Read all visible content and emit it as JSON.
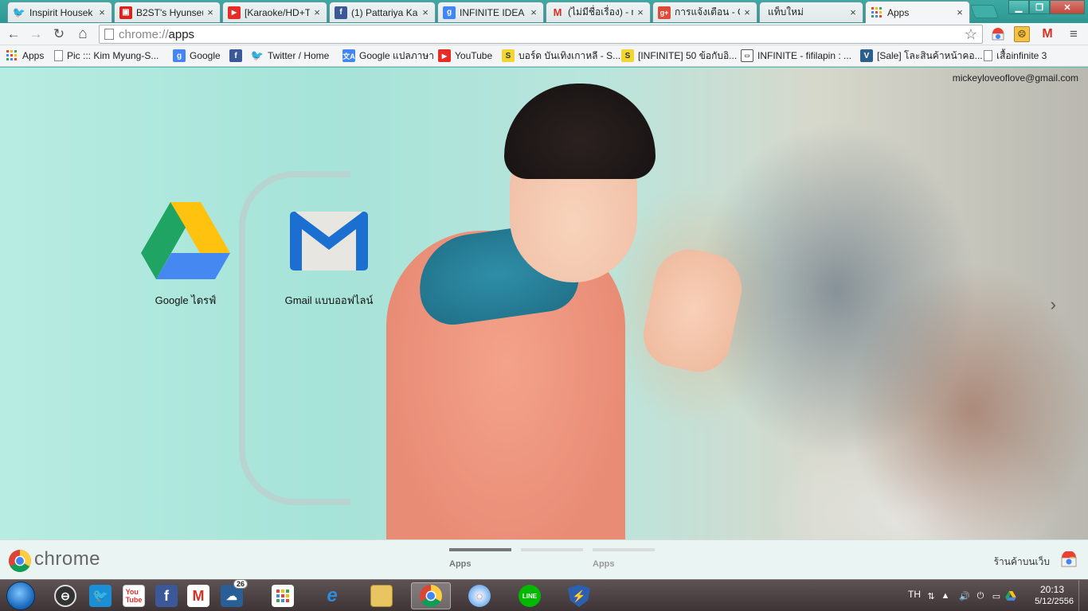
{
  "tabs": [
    {
      "label": "Inspirit Housek",
      "icon": "twitter-icon",
      "active": false
    },
    {
      "label": "B2ST's Hyunseu",
      "icon": "red-square-icon",
      "active": false
    },
    {
      "label": "[Karaoke/HD+T",
      "icon": "youtube-icon",
      "active": false
    },
    {
      "label": "(1) Pattariya Ka",
      "icon": "facebook-icon",
      "active": false
    },
    {
      "label": "INFINITE IDEA |",
      "icon": "google-icon",
      "active": false
    },
    {
      "label": "(ไม่มีชื่อเรื่อง) - m",
      "icon": "gmail-icon",
      "active": false
    },
    {
      "label": "การแจ้งเตือน - G",
      "icon": "google-plus-icon",
      "active": false
    },
    {
      "label": "แท็บใหม่",
      "icon": "",
      "active": false
    },
    {
      "label": "Apps",
      "icon": "apps-grid-icon",
      "active": true
    }
  ],
  "tab_close_glyph": "×",
  "toolbar": {
    "url_scheme": "chrome://",
    "url_host": "apps",
    "back": "←",
    "forward": "→",
    "reload": "↻",
    "home": "⌂",
    "star": "☆"
  },
  "bookmarks": [
    {
      "label": "Apps",
      "icon": "apps-grid-icon"
    },
    {
      "label": "Pic ::: Kim Myung-S...",
      "icon": "page-icon"
    },
    {
      "label": "Google",
      "icon": "google-icon"
    },
    {
      "label": "",
      "icon": "facebook-icon"
    },
    {
      "label": "Twitter / Home",
      "icon": "twitter-icon"
    },
    {
      "label": "Google แปลภาษา",
      "icon": "translate-icon"
    },
    {
      "label": "YouTube",
      "icon": "youtube-icon"
    },
    {
      "label": "บอร์ด บันเทิงเกาหลี - S...",
      "icon": "yellow-s-icon"
    },
    {
      "label": "[INFINITE] 50 ข้อกับอิ...",
      "icon": "yellow-s-icon"
    },
    {
      "label": "INFINITE - fifilapin : ...",
      "icon": "box-icon"
    },
    {
      "label": "[Sale] โละสินค้าหน้าคอ...",
      "icon": "v-icon"
    },
    {
      "label": "เสื้อinfinite 3",
      "icon": "page-icon"
    }
  ],
  "account": "mickeyloveoflove@gmail.com",
  "apps": [
    {
      "label": "Google ไดรฟ์",
      "icon": "google-drive-icon"
    },
    {
      "label": "Gmail แบบออฟไลน์",
      "icon": "gmail-offline-icon"
    }
  ],
  "next_page_glyph": "›",
  "footer": {
    "brand": "chrome",
    "pages": [
      {
        "label": "Apps",
        "active": true
      },
      {
        "label": "",
        "active": false
      },
      {
        "label": "Apps",
        "active": false
      }
    ],
    "webstore_label": "ร้านค้าบนเว็บ"
  },
  "taskbar": {
    "weather_badge": "26",
    "language": "TH",
    "time": "20:13",
    "date": "5/12/2556"
  },
  "colors": {
    "twitter": "#1da1f2",
    "youtube": "#e52d27",
    "facebook": "#3b5998",
    "google": "#4285f4",
    "gmail": "#d93025",
    "google_plus": "#dd4b39",
    "line": "#00b900"
  }
}
